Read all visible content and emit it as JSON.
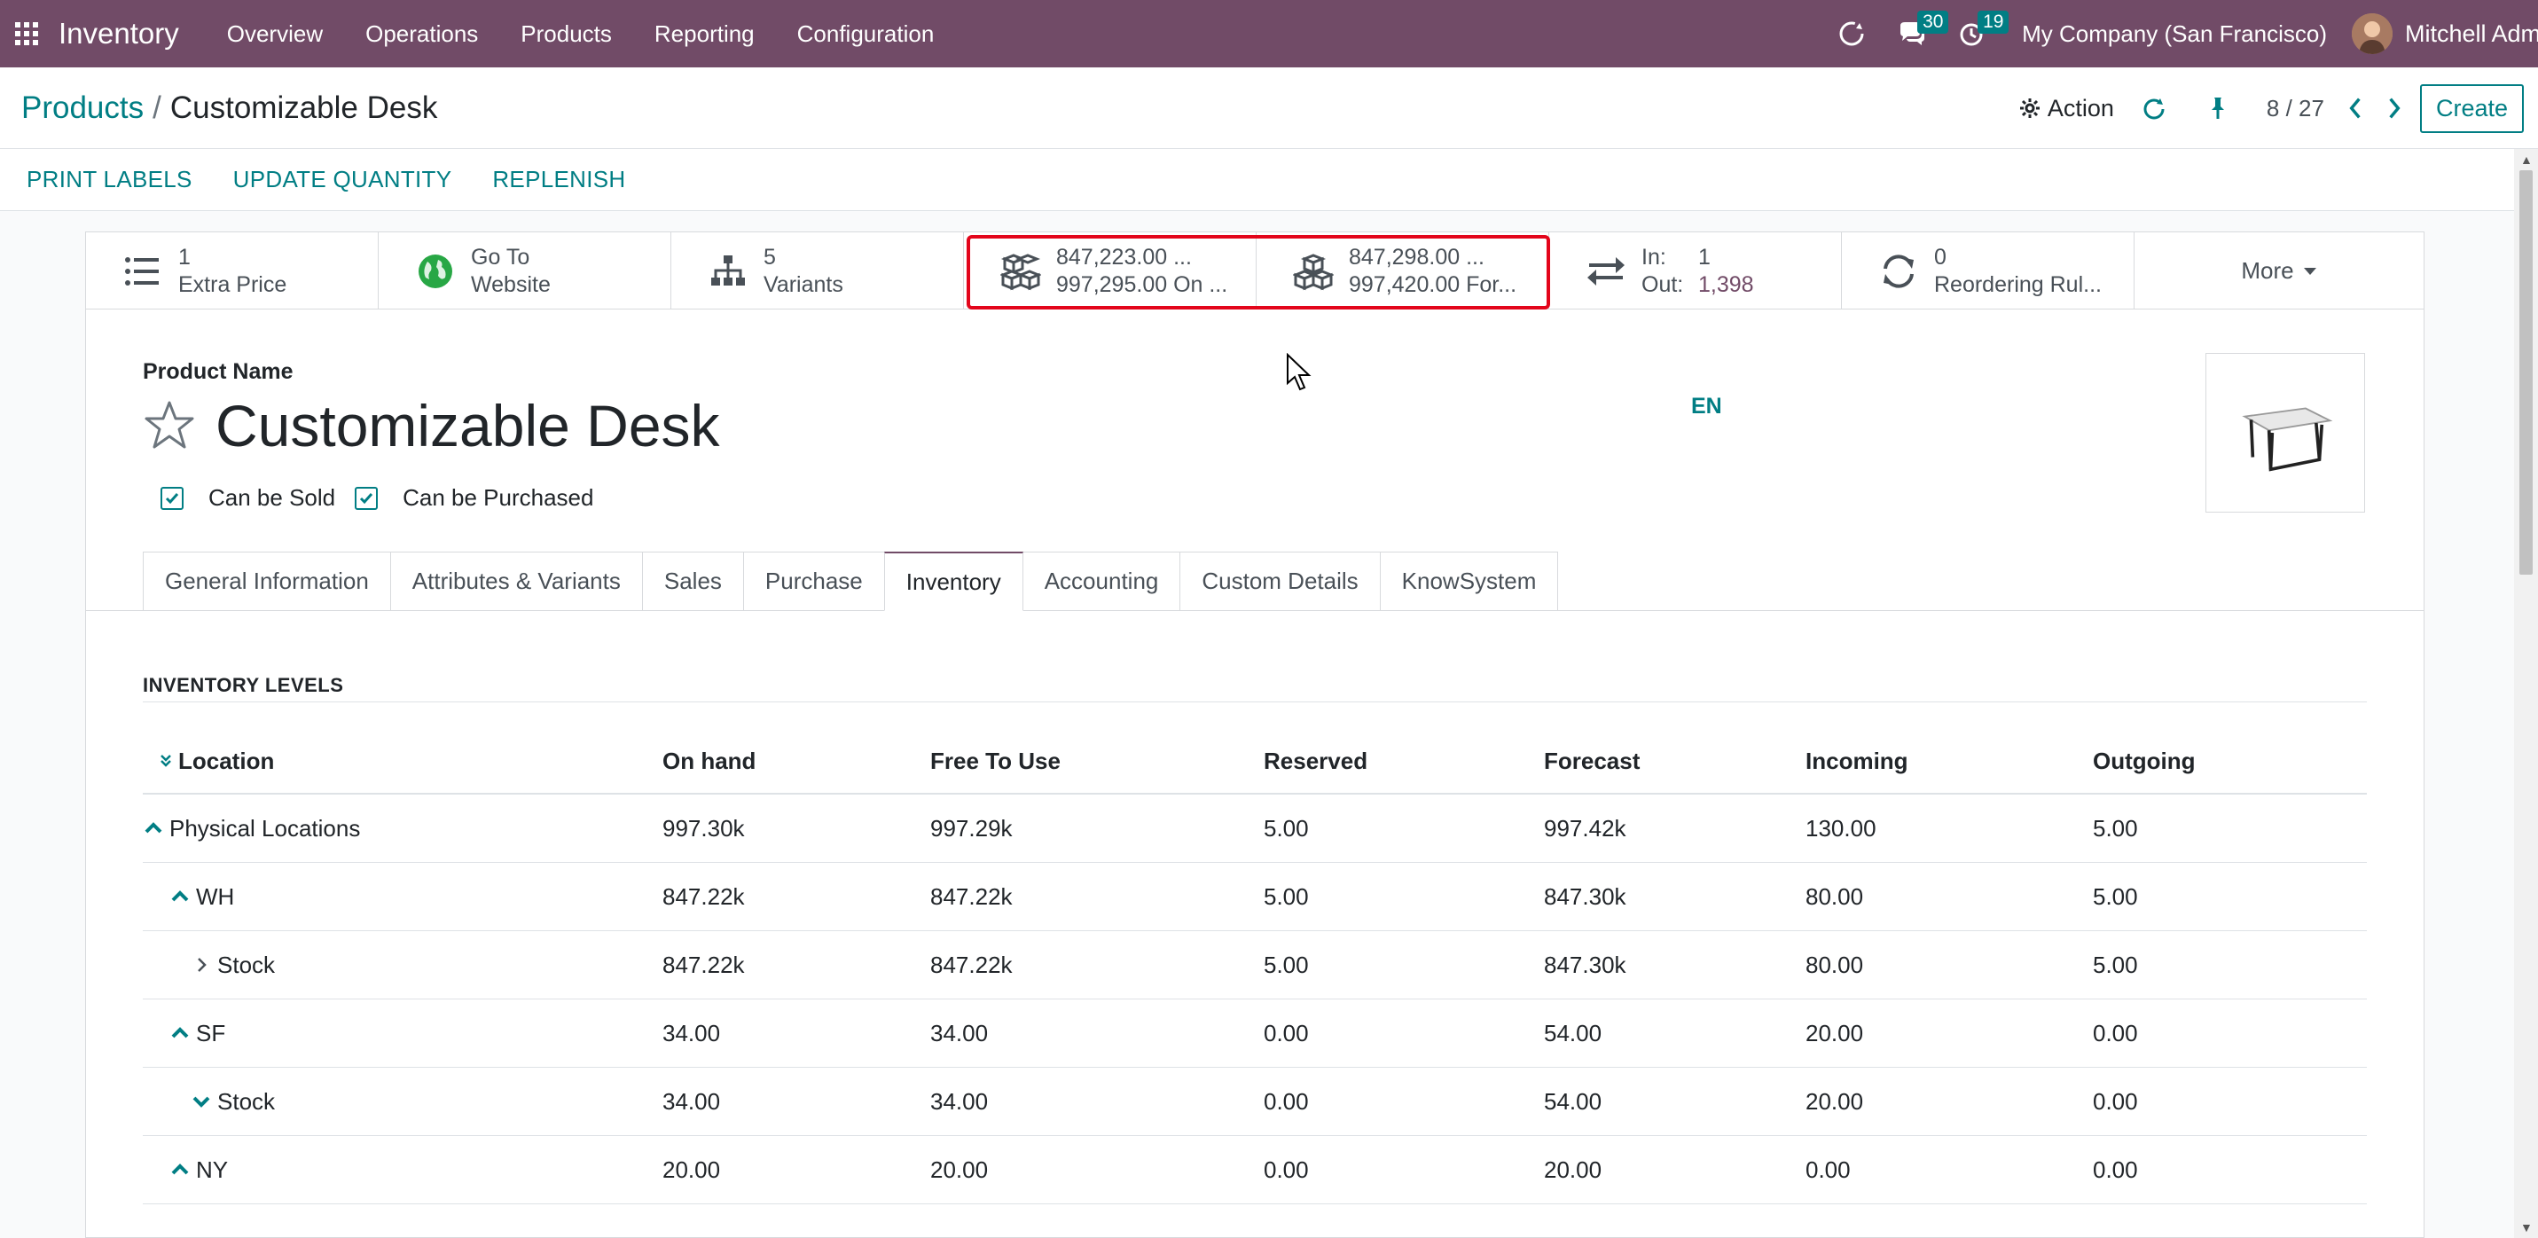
{
  "navbar": {
    "brand": "Inventory",
    "menu": [
      "Overview",
      "Operations",
      "Products",
      "Reporting",
      "Configuration"
    ],
    "messages_badge": "30",
    "activities_badge": "19",
    "company": "My Company (San Francisco)",
    "user": "Mitchell Adm",
    "color": "#714b67"
  },
  "control_panel": {
    "breadcrumb_parent": "Products",
    "breadcrumb_sep": "/",
    "breadcrumb_current": "Customizable Desk",
    "action_label": "Action",
    "pager": "8 / 27",
    "create_label": "Create"
  },
  "statusbar": {
    "buttons": [
      "PRINT LABELS",
      "UPDATE QUANTITY",
      "REPLENISH"
    ]
  },
  "smart_buttons": {
    "extra_price": {
      "value": "1",
      "label": "Extra Price"
    },
    "website": {
      "line1": "Go To",
      "line2": "Website"
    },
    "variants": {
      "value": "5",
      "label": "Variants"
    },
    "on_hand": {
      "line1": "847,223.00 ...",
      "line2": "997,295.00 On ..."
    },
    "forecast": {
      "line1": "847,298.00 ...",
      "line2": "997,420.00 For..."
    },
    "in_out": {
      "in_label": "In:",
      "in_value": "1",
      "out_label": "Out:",
      "out_value": "1,398"
    },
    "reordering": {
      "value": "0",
      "label": "Reordering Rul..."
    },
    "more": "More"
  },
  "product": {
    "name_label": "Product Name",
    "name": "Customizable Desk",
    "lang": "EN",
    "can_be_sold": "Can be Sold",
    "can_be_purchased": "Can be Purchased"
  },
  "tabs": [
    "General Information",
    "Attributes & Variants",
    "Sales",
    "Purchase",
    "Inventory",
    "Accounting",
    "Custom Details",
    "KnowSystem"
  ],
  "active_tab": "Inventory",
  "inventory": {
    "section_title": "INVENTORY LEVELS",
    "headers": [
      "Location",
      "On hand",
      "Free To Use",
      "Reserved",
      "Forecast",
      "Incoming",
      "Outgoing"
    ],
    "rows": [
      {
        "location": "Physical Locations",
        "on_hand": "997.30k",
        "free": "997.29k",
        "reserved": "5.00",
        "forecast": "997.42k",
        "incoming": "130.00",
        "outgoing": "5.00"
      },
      {
        "location": "WH",
        "on_hand": "847.22k",
        "free": "847.22k",
        "reserved": "5.00",
        "forecast": "847.30k",
        "incoming": "80.00",
        "outgoing": "5.00"
      },
      {
        "location": "Stock",
        "on_hand": "847.22k",
        "free": "847.22k",
        "reserved": "5.00",
        "forecast": "847.30k",
        "incoming": "80.00",
        "outgoing": "5.00"
      },
      {
        "location": "SF",
        "on_hand": "34.00",
        "free": "34.00",
        "reserved": "0.00",
        "forecast": "54.00",
        "incoming": "20.00",
        "outgoing": "0.00"
      },
      {
        "location": "Stock",
        "on_hand": "34.00",
        "free": "34.00",
        "reserved": "0.00",
        "forecast": "54.00",
        "incoming": "20.00",
        "outgoing": "0.00"
      },
      {
        "location": "NY",
        "on_hand": "20.00",
        "free": "20.00",
        "reserved": "0.00",
        "forecast": "20.00",
        "incoming": "0.00",
        "outgoing": "0.00"
      }
    ]
  }
}
